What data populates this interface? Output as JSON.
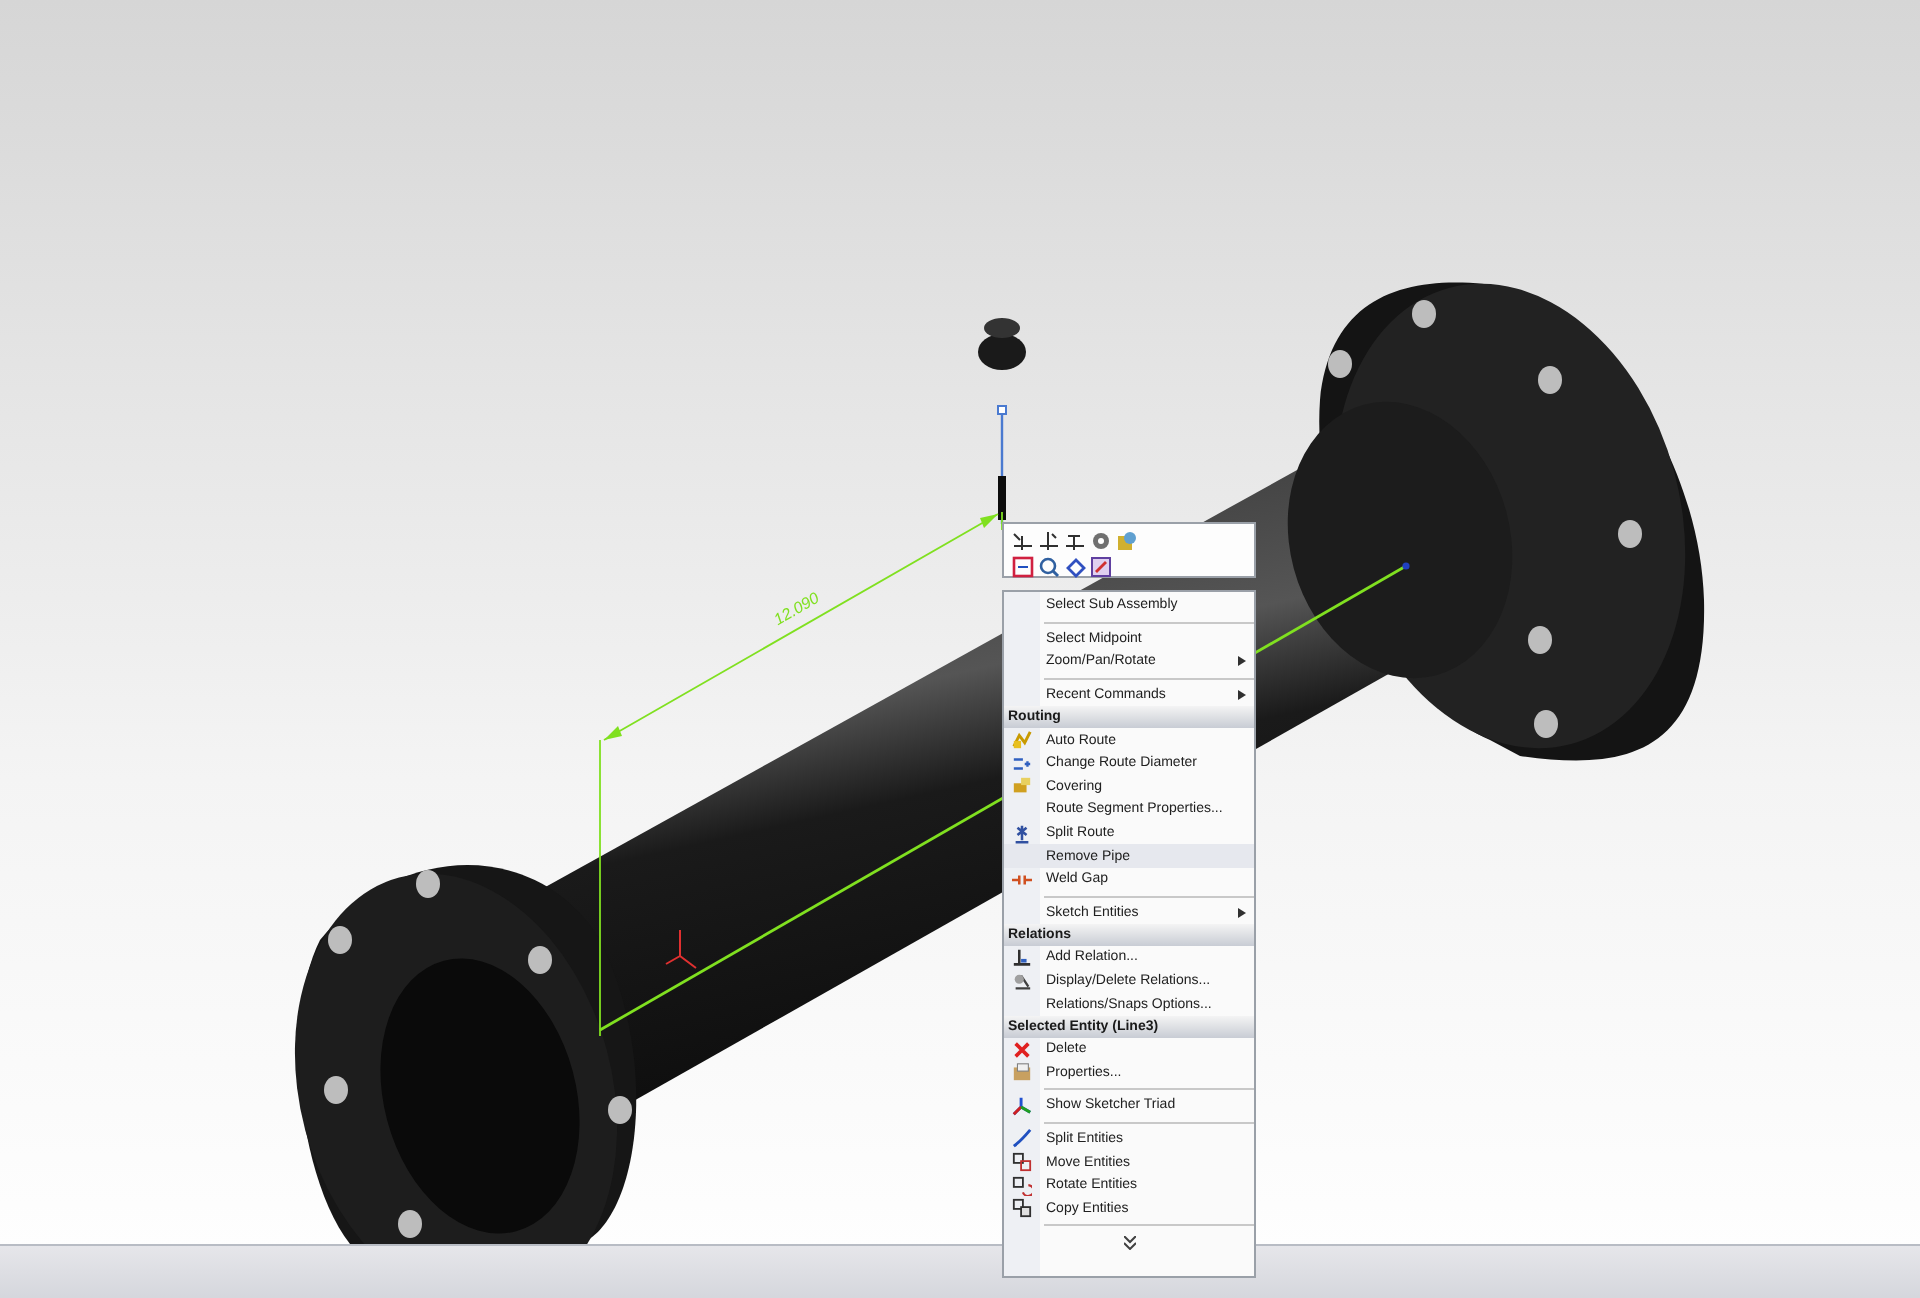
{
  "dimension": {
    "value": "12.090"
  },
  "context_menu": {
    "items": [
      {
        "kind": "item",
        "label": "Select Sub Assembly",
        "submenu": false,
        "selected": false
      },
      {
        "kind": "separator"
      },
      {
        "kind": "item",
        "label": "Select Midpoint",
        "submenu": false,
        "selected": false
      },
      {
        "kind": "item",
        "label": "Zoom/Pan/Rotate",
        "submenu": true,
        "selected": false
      },
      {
        "kind": "separator"
      },
      {
        "kind": "item",
        "label": "Recent Commands",
        "submenu": true,
        "selected": false
      },
      {
        "kind": "header",
        "label": "Routing"
      },
      {
        "kind": "item",
        "label": "Auto Route",
        "submenu": false,
        "selected": false
      },
      {
        "kind": "item",
        "label": "Change Route Diameter",
        "submenu": false,
        "selected": false
      },
      {
        "kind": "item",
        "label": "Covering",
        "submenu": false,
        "selected": false
      },
      {
        "kind": "item",
        "label": "Route Segment Properties...",
        "submenu": false,
        "selected": false
      },
      {
        "kind": "item",
        "label": "Split Route",
        "submenu": false,
        "selected": false
      },
      {
        "kind": "item",
        "label": "Remove Pipe",
        "submenu": false,
        "selected": true
      },
      {
        "kind": "item",
        "label": "Weld Gap",
        "submenu": false,
        "selected": false
      },
      {
        "kind": "separator"
      },
      {
        "kind": "item",
        "label": "Sketch Entities",
        "submenu": true,
        "selected": false
      },
      {
        "kind": "header",
        "label": "Relations"
      },
      {
        "kind": "item",
        "label": "Add Relation...",
        "submenu": false,
        "selected": false
      },
      {
        "kind": "item",
        "label": "Display/Delete Relations...",
        "submenu": false,
        "selected": false
      },
      {
        "kind": "item",
        "label": "Relations/Snaps Options...",
        "submenu": false,
        "selected": false
      },
      {
        "kind": "header",
        "label": "Selected Entity (Line3)"
      },
      {
        "kind": "item",
        "label": "Delete",
        "submenu": false,
        "selected": false
      },
      {
        "kind": "item",
        "label": "Properties...",
        "submenu": false,
        "selected": false
      },
      {
        "kind": "separator"
      },
      {
        "kind": "item",
        "label": "Show Sketcher Triad",
        "submenu": false,
        "selected": false
      },
      {
        "kind": "separator"
      },
      {
        "kind": "item",
        "label": "Split Entities",
        "submenu": false,
        "selected": false
      },
      {
        "kind": "item",
        "label": "Move Entities",
        "submenu": false,
        "selected": false
      },
      {
        "kind": "item",
        "label": "Rotate Entities",
        "submenu": false,
        "selected": false
      },
      {
        "kind": "item",
        "label": "Copy Entities",
        "submenu": false,
        "selected": false
      },
      {
        "kind": "separator"
      },
      {
        "kind": "expand"
      }
    ]
  }
}
